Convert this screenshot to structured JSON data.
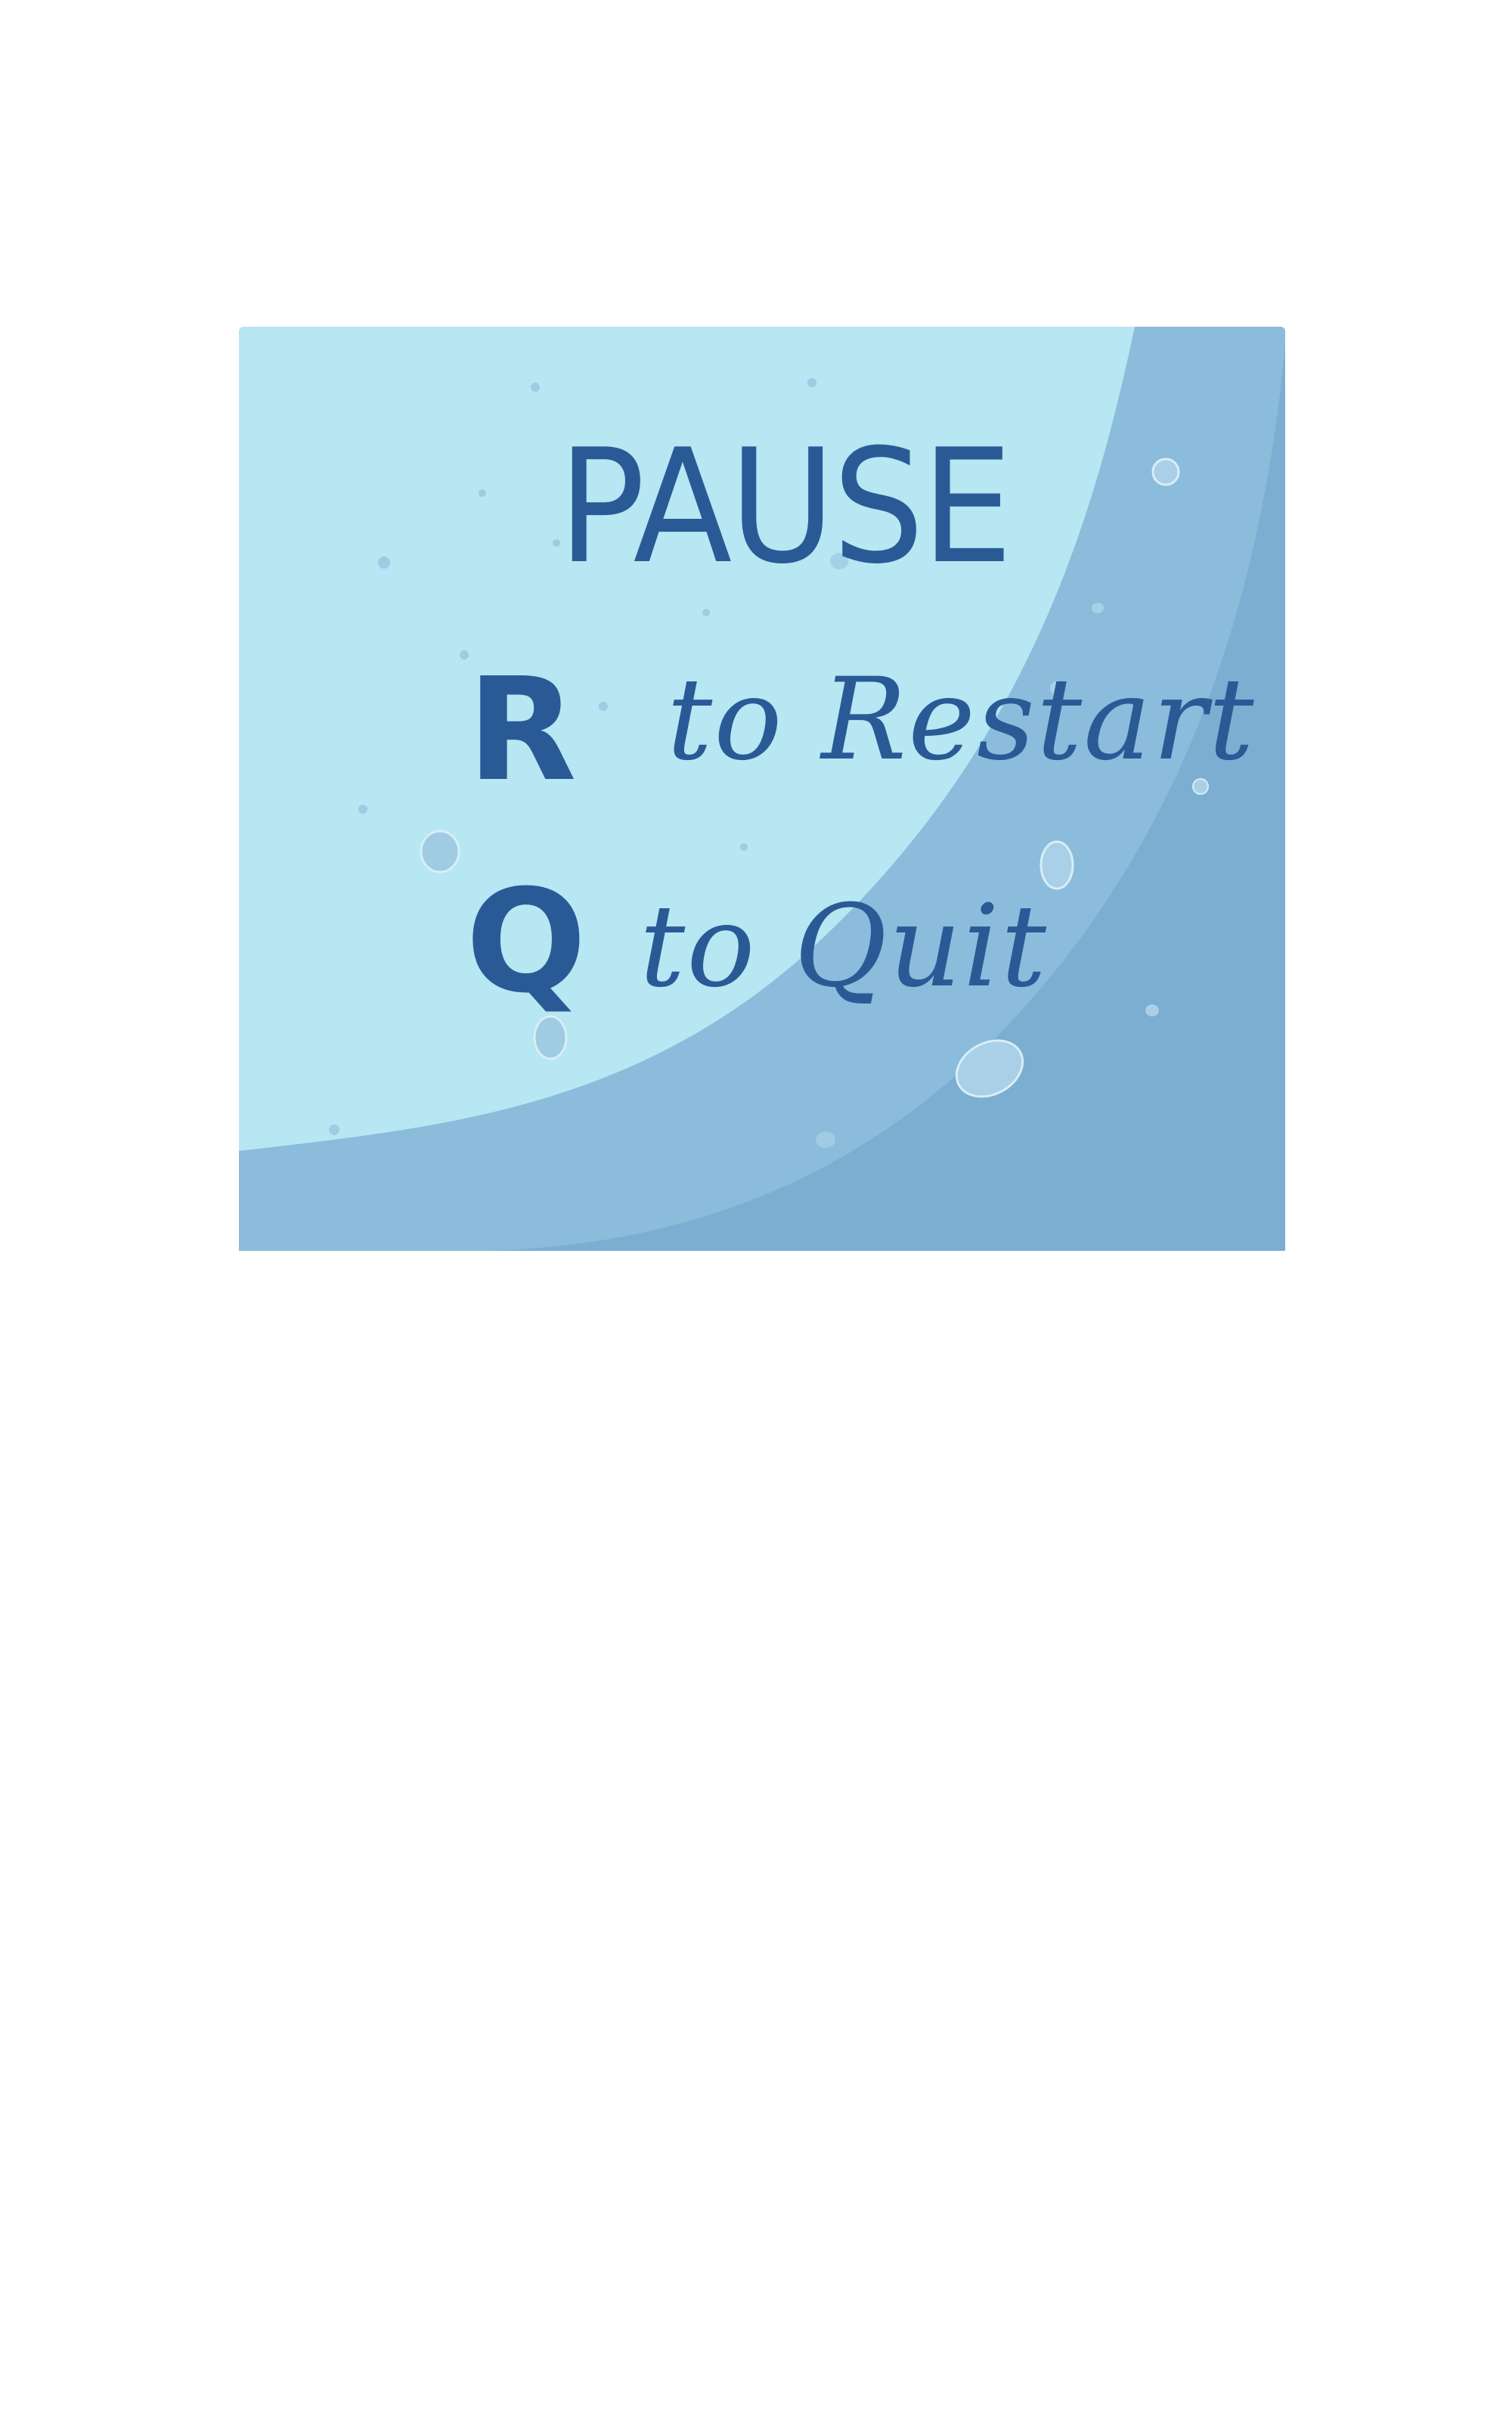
{
  "pause_screen": {
    "title": "PAUSE",
    "options": [
      {
        "key": "R",
        "label": "to Restart"
      },
      {
        "key": "Q",
        "label": "to Quit"
      }
    ]
  },
  "colors": {
    "page_background": "#ffffff",
    "panel_light": "#b6e7f2",
    "panel_mid": "#8bbcdb",
    "panel_dark": "#7caed2",
    "text": "#2a5a96",
    "bubble": "#9fcbe3",
    "bubble_outline": "#dcf1f8"
  }
}
